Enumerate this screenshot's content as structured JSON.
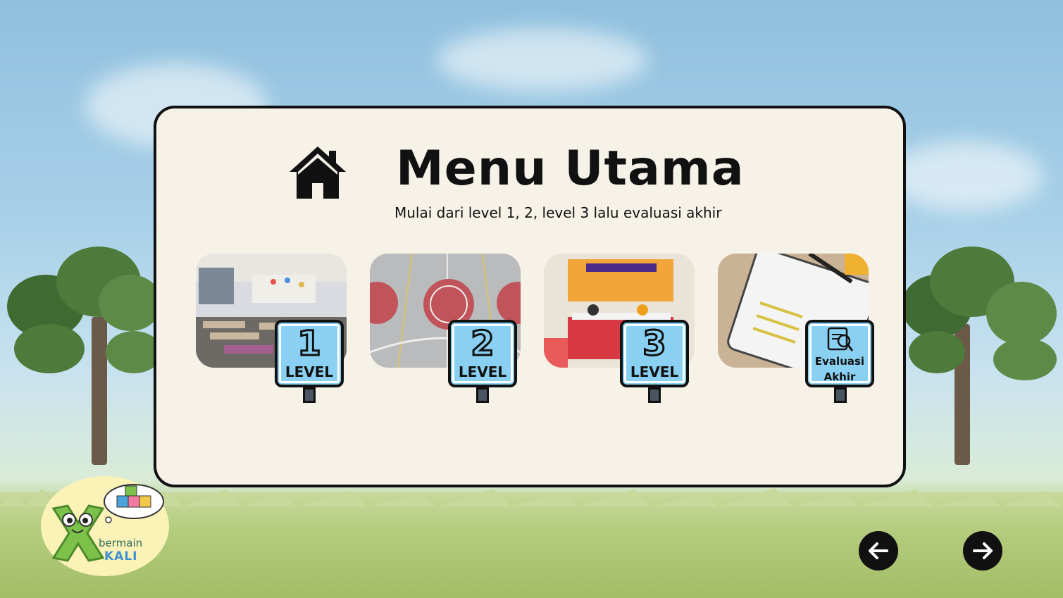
{
  "header": {
    "title": "Menu Utama",
    "subtitle": "Mulai dari level 1, 2, level 3 lalu evaluasi akhir"
  },
  "menu": {
    "cards": [
      {
        "number": "1",
        "label": "LEVEL",
        "image": "classroom-photo"
      },
      {
        "number": "2",
        "label": "LEVEL",
        "image": "schoolyard-court-photo"
      },
      {
        "number": "3",
        "label": "LEVEL",
        "image": "kantin-berseri-photo"
      },
      {
        "line1": "Evaluasi",
        "line2": "Akhir",
        "image": "assessment-photo",
        "icon": "assessment-clipboard-icon"
      }
    ]
  },
  "logo": {
    "line1": "bermain",
    "line2": "KALI"
  },
  "navigation": {
    "prev_icon": "arrow-left-icon",
    "next_icon": "arrow-right-icon"
  },
  "colors": {
    "sign": "#8ad0f2",
    "panel": "#f6f2e8",
    "nav": "#111111"
  }
}
